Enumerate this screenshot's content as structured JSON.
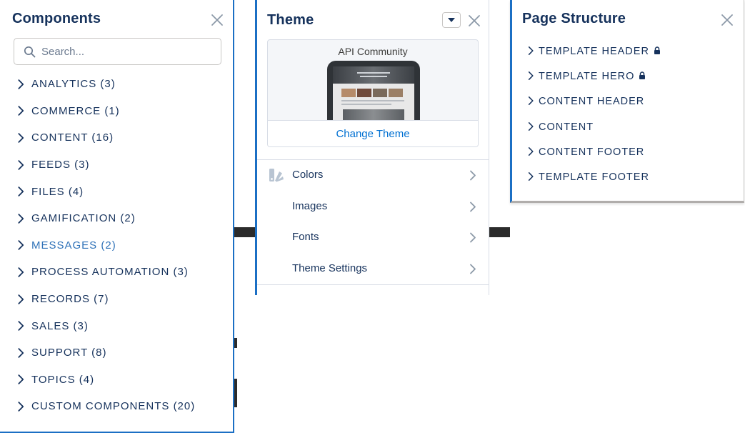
{
  "colors": {
    "accent": "#1b6fc4",
    "text": "#16325c",
    "link": "#0070d2",
    "active_item": "#2f72b8",
    "border": "#d8dde6"
  },
  "components": {
    "title": "Components",
    "close_icon": "close-icon",
    "search": {
      "placeholder": "Search...",
      "value": ""
    },
    "categories": [
      {
        "label": "ANALYTICS (3)"
      },
      {
        "label": "COMMERCE (1)"
      },
      {
        "label": "CONTENT (16)"
      },
      {
        "label": "FEEDS (3)"
      },
      {
        "label": "FILES (4)"
      },
      {
        "label": "GAMIFICATION (2)"
      },
      {
        "label": "MESSAGES (2)",
        "active": true
      },
      {
        "label": "PROCESS AUTOMATION (3)"
      },
      {
        "label": "RECORDS (7)"
      },
      {
        "label": "SALES (3)"
      },
      {
        "label": "SUPPORT (8)"
      },
      {
        "label": "TOPICS (4)"
      },
      {
        "label": "CUSTOM COMPONENTS (20)"
      }
    ]
  },
  "theme": {
    "title": "Theme",
    "current_theme": "API Community",
    "change_theme_label": "Change Theme",
    "menu": [
      {
        "label": "Colors",
        "icon": "paint-palette-icon"
      },
      {
        "label": "Images"
      },
      {
        "label": "Fonts"
      },
      {
        "label": "Theme Settings"
      }
    ]
  },
  "page_structure": {
    "title": "Page Structure",
    "items": [
      {
        "label": "TEMPLATE HEADER",
        "locked": true
      },
      {
        "label": "TEMPLATE HERO",
        "locked": true
      },
      {
        "label": "CONTENT HEADER",
        "locked": false
      },
      {
        "label": "CONTENT",
        "locked": false
      },
      {
        "label": "CONTENT FOOTER",
        "locked": false
      },
      {
        "label": "TEMPLATE FOOTER",
        "locked": false
      }
    ]
  }
}
